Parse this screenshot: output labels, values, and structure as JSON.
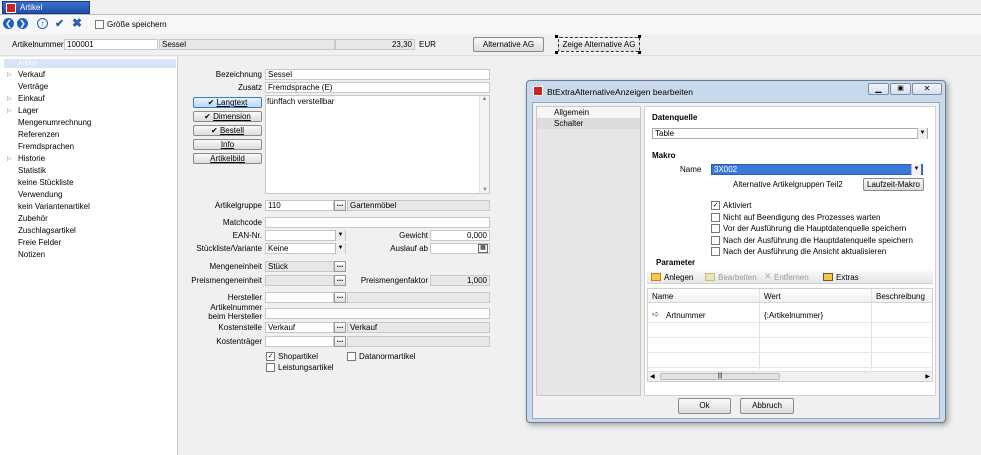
{
  "tab": {
    "label": "Artikel"
  },
  "toolbar": {
    "save_size_label": "Größe speichern",
    "save_size_checked": false
  },
  "header": {
    "artikelnummer_label": "Artikelnummer",
    "artikelnummer_value": "100001",
    "name": "Sessel",
    "price": "23,30",
    "currency": "EUR",
    "alt_button": "Alternative AG",
    "show_alt_button": "Zeige Alternative AG"
  },
  "sidebar": {
    "selected": "Artikel",
    "items": [
      {
        "label": "Verkauf",
        "expandable": true
      },
      {
        "label": "Verträge",
        "expandable": false
      },
      {
        "label": "Einkauf",
        "expandable": true
      },
      {
        "label": "Lager",
        "expandable": true
      },
      {
        "label": "Mengenumrechnung",
        "expandable": false
      },
      {
        "label": "Referenzen",
        "expandable": false
      },
      {
        "label": "Fremdsprachen",
        "expandable": false
      },
      {
        "label": "Historie",
        "expandable": true
      },
      {
        "label": "Statistik",
        "expandable": false
      },
      {
        "label": "keine Stückliste",
        "expandable": false
      },
      {
        "label": "Verwendung",
        "expandable": false
      },
      {
        "label": "kein Variantenartikel",
        "expandable": false
      },
      {
        "label": "Zubehör",
        "expandable": false
      },
      {
        "label": "Zuschlagsartikel",
        "expandable": false
      },
      {
        "label": "Freie Felder",
        "expandable": false
      },
      {
        "label": "Notizen",
        "expandable": false
      }
    ]
  },
  "form": {
    "bezeichnung_label": "Bezeichnung",
    "bezeichnung_value": "Sessel",
    "zusatz_label": "Zusatz",
    "zusatz_value": "Fremdsprache (E)",
    "langtext_value": "fünffach verstellbar",
    "buttons": {
      "langtext": "Langtext",
      "dimension": "Dimension",
      "bestell": "Bestell",
      "info": "Info",
      "artikelbild": "Artikelbild"
    },
    "artikelgruppe_label": "Artikelgruppe",
    "artikelgruppe_value": "110",
    "artikelgruppe_name": "Gartenmöbel",
    "matchcode_label": "Matchcode",
    "matchcode_value": "",
    "ean_label": "EAN-Nr.",
    "ean_value": "",
    "gewicht_label": "Gewicht",
    "gewicht_value": "0,000",
    "stueckliste_label": "Stückliste/Variante",
    "stueckliste_value": "Keine",
    "auslauf_label": "Auslauf ab",
    "auslauf_value": "",
    "mengeneinheit_label": "Mengeneinheit",
    "mengeneinheit_value": "Stück",
    "preismengeneinheit_label": "Preismengeneinheit",
    "preismengeneinheit_value": "",
    "preismengenfaktor_label": "Preismengenfaktor",
    "preismengenfaktor_value": "1,000",
    "hersteller_label": "Hersteller",
    "hersteller_value": "",
    "artnr_hersteller_label1": "Artikelnummer",
    "artnr_hersteller_label2": "beim Hersteller",
    "artnr_hersteller_value": "",
    "kostenstelle_label": "Kostenstelle",
    "kostenstelle_value": "Verkauf",
    "kostenstelle_name": "Verkauf",
    "kostentraeger_label": "Kostenträger",
    "kostentraeger_value": "",
    "shopartikel_label": "Shopartikel",
    "shopartikel_checked": true,
    "datanorm_label": "Datanormartikel",
    "datanorm_checked": false,
    "leistung_label": "Leistungsartikel",
    "leistung_checked": false
  },
  "dialog": {
    "title": "BtExtraAlternativeAnzeigen bearbeiten",
    "tabs": [
      "Allgemein",
      "Schalter"
    ],
    "datenquelle_label": "Datenquelle",
    "datenquelle_value": "Table",
    "makro_label": "Makro",
    "name_label": "Name",
    "name_value": "3X002",
    "makro_desc": "Alternative Artikelgruppen Teil2",
    "laufzeit_button": "Laufzeit-Makro",
    "checkboxes": [
      {
        "label": "Aktiviert",
        "checked": true
      },
      {
        "label": "Nicht auf Beendigung des Prozesses warten",
        "checked": false
      },
      {
        "label": "Vor der Ausführung die Hauptdatenquelle speichern",
        "checked": false
      },
      {
        "label": "Nach der Ausführung die Hauptdatenquelle speichern",
        "checked": false
      },
      {
        "label": "Nach der Ausführung die Ansicht aktualisieren",
        "checked": false
      }
    ],
    "parameter_label": "Parameter",
    "param_toolbar": {
      "anlegen": "Anlegen",
      "bearbeiten": "Bearbeiten",
      "entfernen": "Entfernen",
      "extras": "Extras"
    },
    "columns": [
      "Name",
      "Wert",
      "Beschreibung"
    ],
    "rows": [
      {
        "name": "Artnummer",
        "wert": "{:Artikelnummer}",
        "beschreibung": ""
      }
    ],
    "ok_button": "Ok",
    "cancel_button": "Abbruch"
  }
}
